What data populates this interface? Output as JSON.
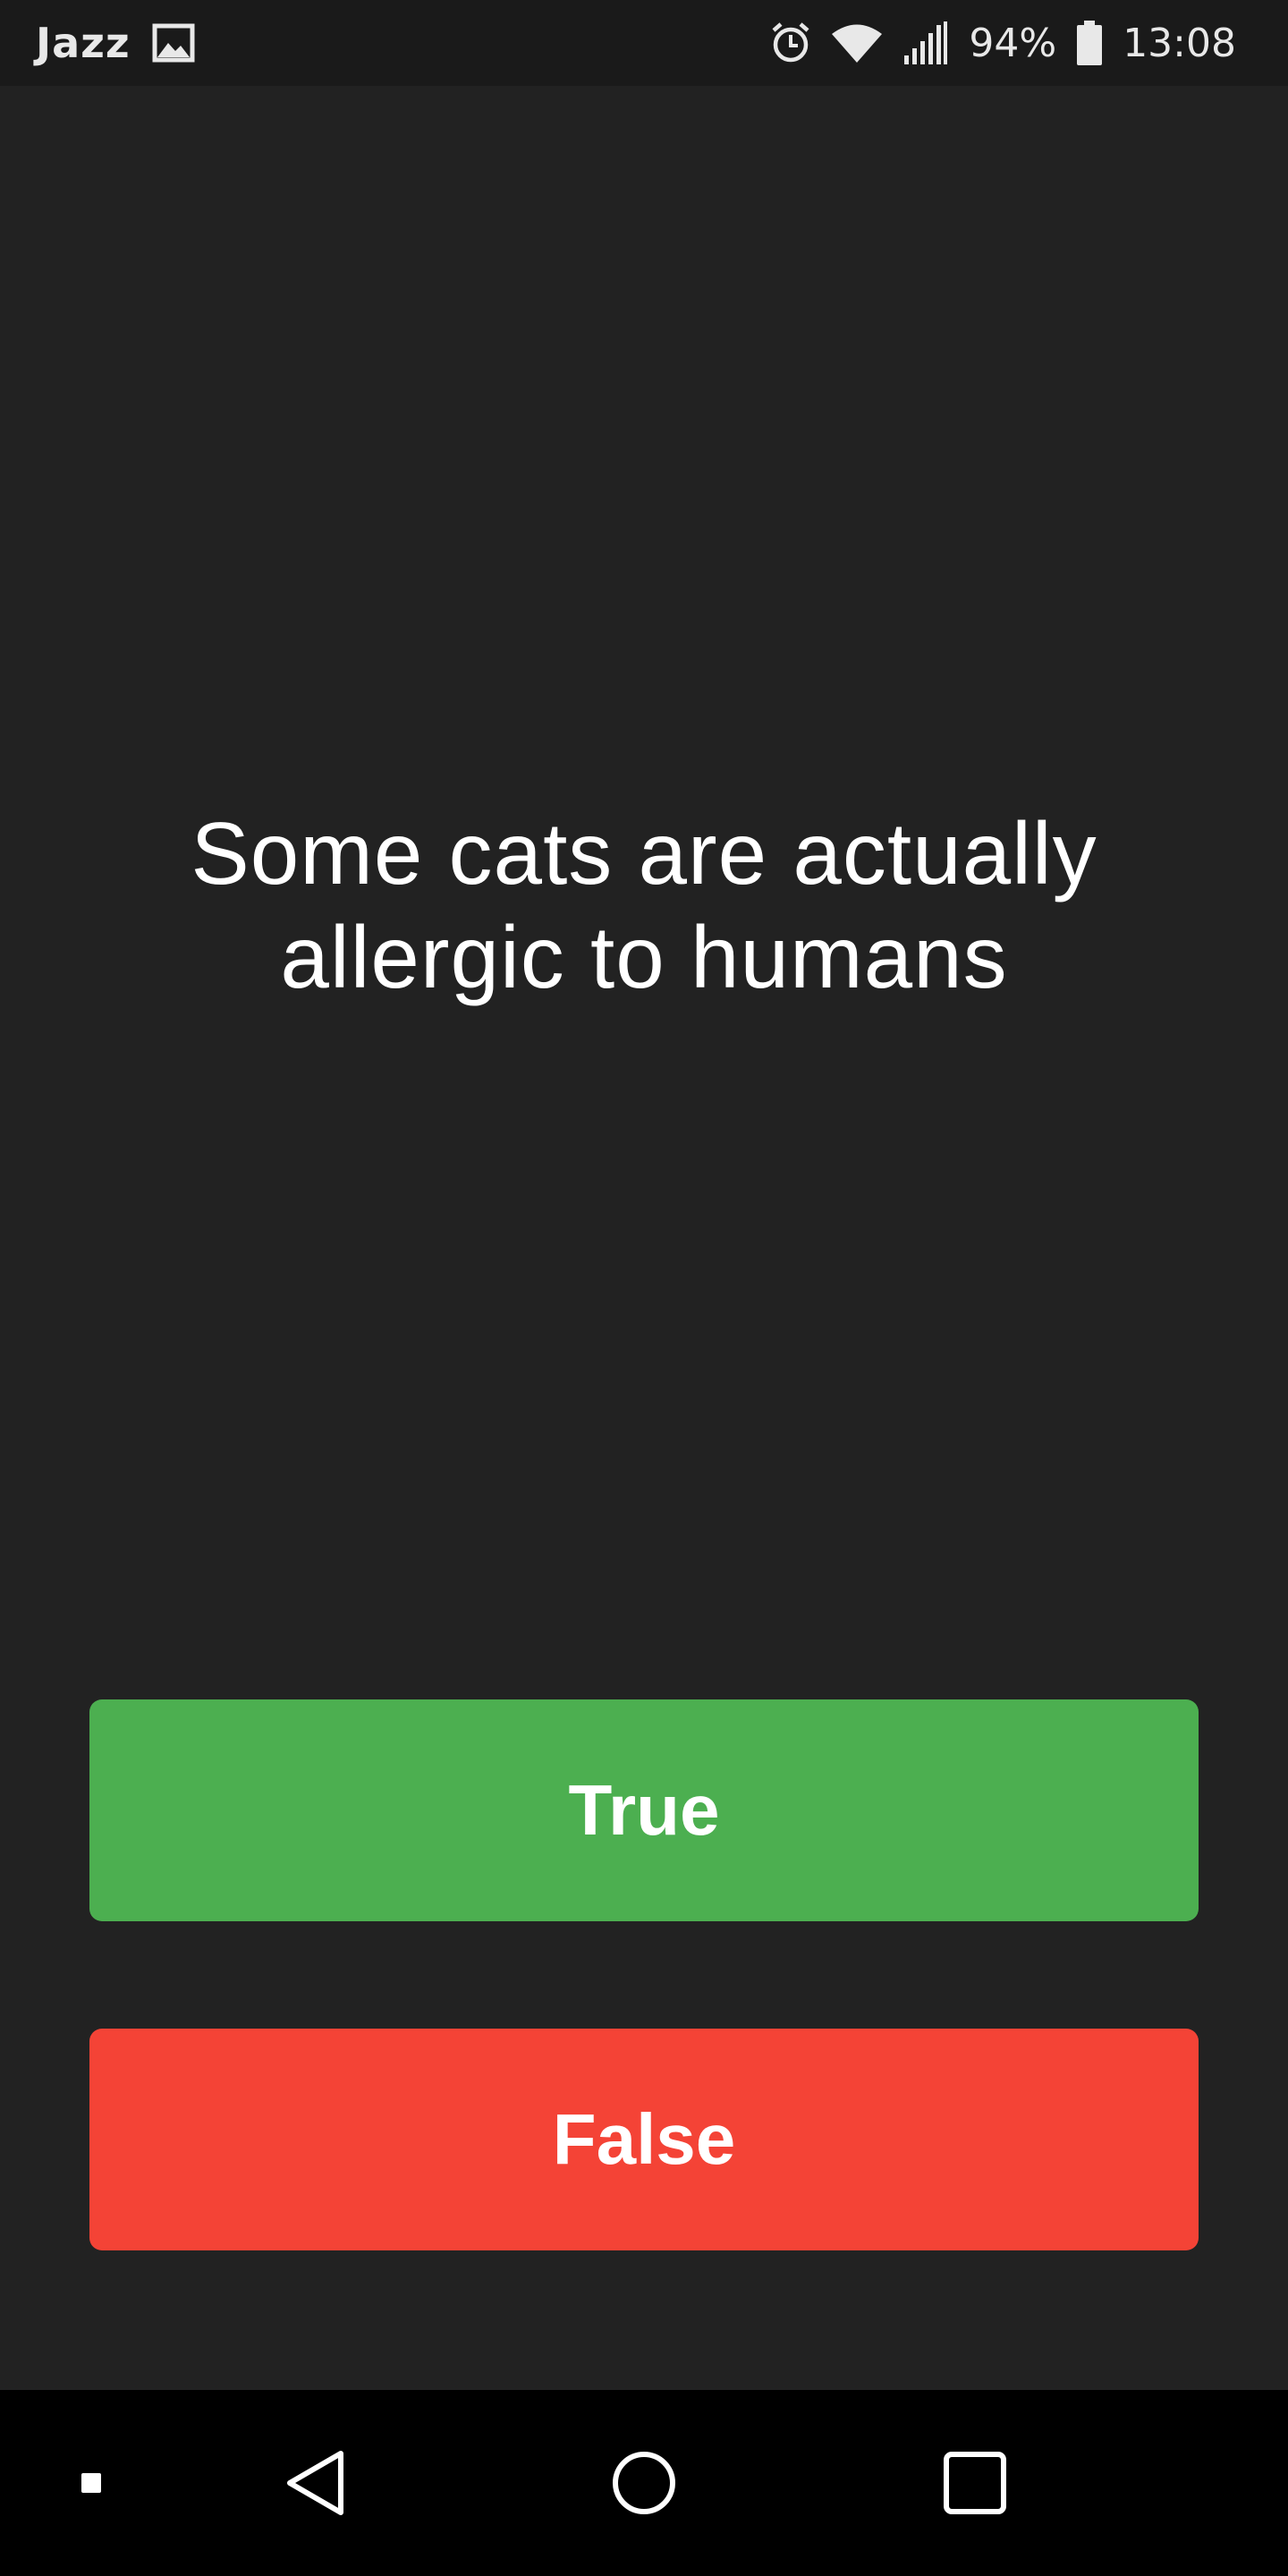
{
  "status_bar": {
    "carrier": "Jazz",
    "battery": "94%",
    "time": "13:08",
    "icons": [
      "image-icon",
      "alarm-icon",
      "wifi-icon",
      "signal-icon",
      "battery-icon"
    ]
  },
  "question": {
    "text": "Some cats are actually allergic to humans"
  },
  "buttons": {
    "true_label": "True",
    "false_label": "False"
  },
  "colors": {
    "background": "#222222",
    "status_bar": "#1a1a1a",
    "true_button": "#4caf50",
    "false_button": "#f44336",
    "nav_bar": "#000000"
  },
  "nav_bar": {
    "icons": [
      "menu-square-icon",
      "back-icon",
      "home-icon",
      "recents-icon"
    ]
  }
}
